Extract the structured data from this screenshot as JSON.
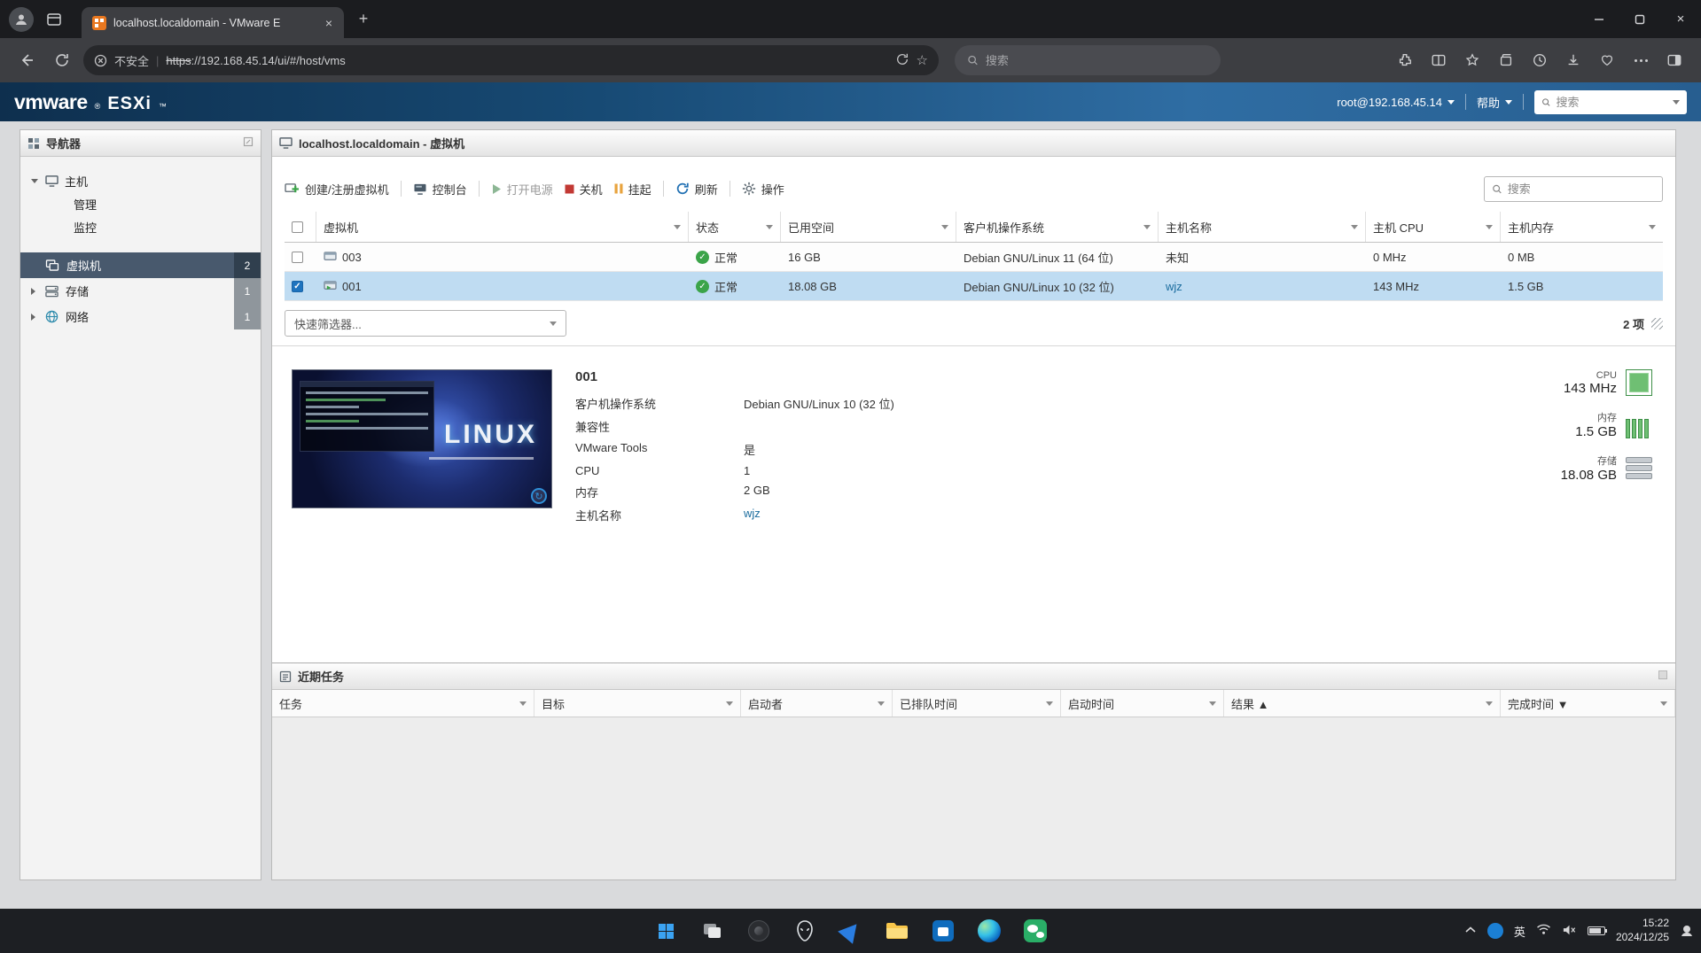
{
  "icons": {
    "close": "×",
    "plus": "+",
    "check": "✓",
    "star": "☆",
    "separator": "|",
    "refresh_glyph": "↻"
  },
  "browser": {
    "tab_title": "localhost.localdomain - VMware E",
    "url_security": "不安全",
    "url_https": "https",
    "url_rest": "://192.168.45.14/ui/#/host/vms",
    "search_placeholder": "搜索"
  },
  "esxi": {
    "logo_vmware": "vmware",
    "logo_reg": "®",
    "logo_product": "ESXi",
    "logo_tm": "™",
    "user_menu": "root@192.168.45.14",
    "help_menu": "帮助",
    "search_placeholder": "搜索"
  },
  "sidebar": {
    "title": "导航器",
    "host": {
      "label": "主机",
      "children": [
        {
          "label": "管理"
        },
        {
          "label": "监控"
        }
      ]
    },
    "items": [
      {
        "label": "虚拟机",
        "badge": "2"
      },
      {
        "label": "存储",
        "badge": "1"
      },
      {
        "label": "网络",
        "badge": "1"
      }
    ]
  },
  "main": {
    "title": "localhost.localdomain - 虚拟机",
    "toolbar": {
      "create": "创建/注册虚拟机",
      "console": "控制台",
      "power_on": "打开电源",
      "power_off": "关机",
      "suspend": "挂起",
      "refresh": "刷新",
      "actions": "操作"
    },
    "search_placeholder": "搜索",
    "table": {
      "columns": {
        "vm": "虚拟机",
        "status": "状态",
        "space": "已用空间",
        "os": "客户机操作系统",
        "hostname": "主机名称",
        "cpu": "主机 CPU",
        "memory": "主机内存"
      },
      "rows": [
        {
          "name": "003",
          "status": "正常",
          "space": "16 GB",
          "os": "Debian GNU/Linux 11 (64 位)",
          "hostname": "未知",
          "cpu": "0 MHz",
          "memory": "0 MB"
        },
        {
          "name": "001",
          "status": "正常",
          "space": "18.08 GB",
          "os": "Debian GNU/Linux 10 (32 位)",
          "hostname": "wjz",
          "cpu": "143 MHz",
          "memory": "1.5 GB"
        }
      ],
      "quick_filter": "快速筛选器...",
      "item_count": "2 项"
    },
    "detail": {
      "name": "001",
      "thumb_text": "LINUX",
      "fields": [
        {
          "label": "客户机操作系统",
          "value": "Debian GNU/Linux 10 (32 位)"
        },
        {
          "label": "兼容性",
          "value": ""
        },
        {
          "label": "VMware Tools",
          "value": "是"
        },
        {
          "label": "CPU",
          "value": "1"
        },
        {
          "label": "内存",
          "value": "2 GB"
        },
        {
          "label": "主机名称",
          "value": "wjz"
        }
      ],
      "stats": [
        {
          "label": "CPU",
          "value": "143 MHz"
        },
        {
          "label": "内存",
          "value": "1.5 GB"
        },
        {
          "label": "存储",
          "value": "18.08 GB"
        }
      ]
    }
  },
  "tasks": {
    "title": "近期任务",
    "columns": [
      "任务",
      "目标",
      "启动者",
      "已排队时间",
      "启动时间",
      "结果 ▲",
      "完成时间 ▼"
    ]
  },
  "taskbar": {
    "time": "15:22",
    "date": "2024/12/25",
    "lang": "英"
  }
}
